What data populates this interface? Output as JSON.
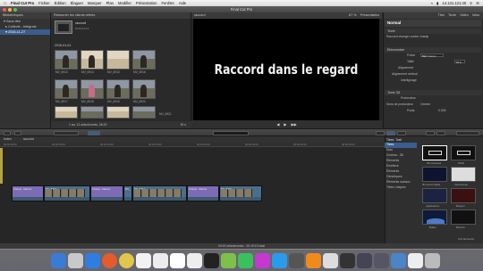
{
  "menubar": {
    "app": "Final Cut Pro",
    "items": [
      "Fichier",
      "Édition",
      "Élaguer",
      "Marquer",
      "Plan",
      "Modifier",
      "Présentation",
      "Fenêtre",
      "Aide"
    ],
    "clock": "14.131.121:40"
  },
  "window": {
    "title": "Final Cut Pro"
  },
  "library": {
    "header": "Bibliothèques",
    "items": [
      "Sans titre",
      "Collecte...Intégrale",
      "2016-11-27"
    ]
  },
  "browser": {
    "header": "Retourner les clients retirés",
    "project_name": "raccord",
    "project_date": "2016-01-13",
    "date_group": "2016-01-01",
    "clip_labels": [
      "MV_6913",
      "MV_6914",
      "MV_6915",
      "MV_6916",
      "MV_6917",
      "MV_6918",
      "MV_6919",
      "MV_6920",
      "MV_6921"
    ],
    "footer": "1 sur 13 sélectionnés, 08:20",
    "footer_right": "90 s"
  },
  "viewer": {
    "header_left": "raccord",
    "zoom": "67 %",
    "view": "Présentation",
    "caption": "Raccord dans le regard"
  },
  "inspector": {
    "tabs": [
      "Titre",
      "Texte",
      "Vidéo",
      "Infos"
    ],
    "title": "Normal",
    "section_text": "Texte",
    "text_value": "Raccord changer contre champ",
    "section_basic": "Élémentaire",
    "rows": [
      "Police",
      "Taille",
      "Alignement",
      "Alignement vertical",
      "Interlignage"
    ],
    "font": "BEV Const...",
    "size": "63.0",
    "section_3d": "Texte 3D",
    "depth_label": "Profondeur",
    "depth_dir": "Sens de profondeur",
    "depth_dir_value": "Centrer",
    "weight_label": "Poids",
    "weight_value": "0.000"
  },
  "timeline": {
    "index_label": "Index",
    "project": "raccord",
    "ruler": [
      "00:00:00:00",
      "00:00:05:00",
      "00:00:10:00",
      "00:00:15:00",
      "00:00:20:00",
      "00:00:25:00",
      "00:00:30:00",
      "00:00:35:00",
      "00:00:40:00"
    ],
    "clip_labels": [
      "Champ - Raccor",
      "MV_6913",
      "Champ - Raccor",
      "MV_",
      "MV_6914",
      "Champ - Raccor",
      "MV_6916"
    ]
  },
  "generators": {
    "header": "Titres",
    "header2": "Trait",
    "categories": [
      "Titres",
      "Nom",
      "Cinéma - 3D",
      "Éléments",
      "Émetteur",
      "Éléments",
      "Génériques",
      "Éléments sociaux",
      "Titres Uniques"
    ],
    "items": [
      "3D Universel",
      "NOIR",
      "3D personnalisé",
      "Caméscope",
      "Applications",
      "Bonjour",
      "Bulles",
      "Burners"
    ],
    "footer": "144 éléments"
  },
  "status_bar": "00:00 sélectionnés - 00:19:19 total",
  "colors": {
    "accent": "#3a5d8f",
    "title_clip": "#7d6bb5",
    "video_clip": "#4a6f8d"
  }
}
